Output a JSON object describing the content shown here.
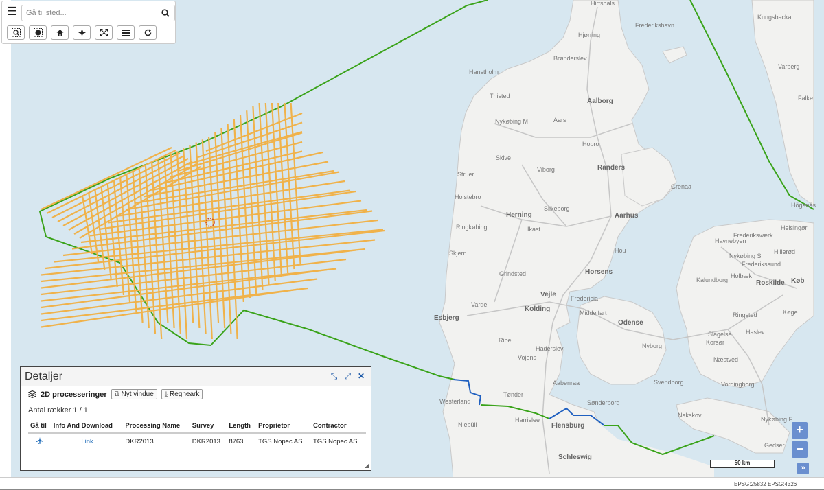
{
  "search": {
    "placeholder": "Gå til sted..."
  },
  "toolbar": {
    "buttons": [
      {
        "name": "zoom-extent-button",
        "icon": "zoom-box-icon"
      },
      {
        "name": "info-button",
        "icon": "info-icon"
      },
      {
        "name": "home-button",
        "icon": "home-icon"
      },
      {
        "name": "locate-button",
        "icon": "crosshair-icon"
      },
      {
        "name": "fullscreen-button",
        "icon": "expand-icon"
      },
      {
        "name": "layers-button",
        "icon": "list-icon"
      },
      {
        "name": "refresh-button",
        "icon": "refresh-icon"
      }
    ]
  },
  "map": {
    "labels": [
      {
        "text": "Hirtshals"
      },
      {
        "text": "Frederikshavn"
      },
      {
        "text": "Hjørring"
      },
      {
        "text": "Brønderslev"
      },
      {
        "text": "Kungsbacka"
      },
      {
        "text": "Varberg"
      },
      {
        "text": "Falke"
      },
      {
        "text": "Hanstholm"
      },
      {
        "text": "Thisted"
      },
      {
        "text": "Aalborg"
      },
      {
        "text": "Nykøbing M"
      },
      {
        "text": "Aars"
      },
      {
        "text": "Hobro"
      },
      {
        "text": "Skive"
      },
      {
        "text": "Viborg"
      },
      {
        "text": "Randers"
      },
      {
        "text": "Struer"
      },
      {
        "text": "Grenaa"
      },
      {
        "text": "Holstebro"
      },
      {
        "text": "Silkeborg"
      },
      {
        "text": "Herning"
      },
      {
        "text": "Aarhus"
      },
      {
        "text": "Ringkøbing"
      },
      {
        "text": "Ikast"
      },
      {
        "text": "Skjern"
      },
      {
        "text": "Hou"
      },
      {
        "text": "Horsens"
      },
      {
        "text": "Grindsted"
      },
      {
        "text": "Vejle"
      },
      {
        "text": "Fredericia"
      },
      {
        "text": "Varde"
      },
      {
        "text": "Esbjerg"
      },
      {
        "text": "Kolding"
      },
      {
        "text": "Middelfart"
      },
      {
        "text": "Odense"
      },
      {
        "text": "Ribe"
      },
      {
        "text": "Haderslev"
      },
      {
        "text": "Nyborg"
      },
      {
        "text": "Vojens"
      },
      {
        "text": "Svendborg"
      },
      {
        "text": "Aabenraa"
      },
      {
        "text": "Tønder"
      },
      {
        "text": "Sønderborg"
      },
      {
        "text": "Westerland"
      },
      {
        "text": "Niebüll"
      },
      {
        "text": "Harrislee"
      },
      {
        "text": "Flensburg"
      },
      {
        "text": "Schleswig"
      },
      {
        "text": "Höganäs"
      },
      {
        "text": "Helsingør"
      },
      {
        "text": "Frederiksværk"
      },
      {
        "text": "Hillerød"
      },
      {
        "text": "Havnebyen"
      },
      {
        "text": "Nykøbing S"
      },
      {
        "text": "Frederikssund"
      },
      {
        "text": "Holbæk"
      },
      {
        "text": "Kalundborg"
      },
      {
        "text": "Roskilde"
      },
      {
        "text": "Køb"
      },
      {
        "text": "Ringsted"
      },
      {
        "text": "Køge"
      },
      {
        "text": "Slagelse"
      },
      {
        "text": "Haslev"
      },
      {
        "text": "Korsør"
      },
      {
        "text": "Næstved"
      },
      {
        "text": "Vordingborg"
      },
      {
        "text": "Nakskov"
      },
      {
        "text": "Nykøbing F"
      },
      {
        "text": "Gedser"
      }
    ]
  },
  "details": {
    "title": "Detaljer",
    "layer_name": "2D processeringer",
    "new_window_label": "Nyt vindue",
    "spreadsheet_label": "Regneark",
    "row_count": "Antal rækker 1 / 1",
    "columns": [
      "Gå til",
      "Info And Download",
      "Processing Name",
      "Survey",
      "Length",
      "Proprietor",
      "Contractor"
    ],
    "rows": [
      {
        "goto_icon": "airplane-icon",
        "link": "Link",
        "processing_name": "DKR2013",
        "survey": "DKR2013",
        "length": "8763",
        "proprietor": "TGS Nopec AS",
        "contractor": "TGS Nopec AS"
      }
    ]
  },
  "zoom": {
    "in": "+",
    "out": "−",
    "expand": "»"
  },
  "scale": {
    "label": "50 km"
  },
  "status": {
    "epsg1": "EPSG:25832 :",
    "epsg2": "EPSG:4326 :"
  },
  "colors": {
    "sea": "#d7e7f0",
    "land": "#f2f2f0",
    "survey_lines": "#f0b24a",
    "boundary": "#3aa31a",
    "border": "#2060c0",
    "accent": "#6a8fcf"
  }
}
